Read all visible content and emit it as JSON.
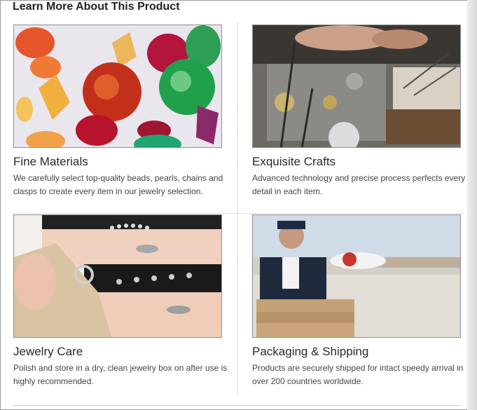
{
  "section": {
    "heading": "Learn More About This Product"
  },
  "cards": [
    {
      "title": "Fine Materials",
      "description": "We carefully select top-quality beads, pearls, chains and clasps to create every item in our jewelry selection.",
      "image_subject": "gemstones"
    },
    {
      "title": "Exquisite Crafts",
      "description": "Advanced technology and precise process perfects every detail in each item.",
      "image_subject": "jewelry-workbench"
    },
    {
      "title": "Jewelry Care",
      "description": "Polish and store in a dry, clean jewelry box on after use is highly recommended.",
      "image_subject": "jewelry-box"
    },
    {
      "title": "Packaging & Shipping",
      "description": "Products are securely shipped for intact speedy arrival in over 200 countries worldwide.",
      "image_subject": "courier-with-boxes"
    }
  ],
  "colors": {
    "text_dark": "#2a2a2a",
    "text_body": "#444444",
    "border": "#8f8f8f"
  }
}
